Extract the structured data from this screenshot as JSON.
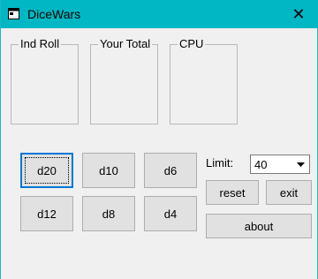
{
  "window": {
    "title": "DiceWars",
    "close_glyph": "✕"
  },
  "groups": {
    "ind_roll": "Ind Roll",
    "your_total": "Your Total",
    "cpu": "CPU"
  },
  "dice_buttons": {
    "d20": "d20",
    "d10": "d10",
    "d6": "d6",
    "d12": "d12",
    "d8": "d8",
    "d4": "d4"
  },
  "limit": {
    "label": "Limit:",
    "value": "40"
  },
  "actions": {
    "reset": "reset",
    "exit": "exit",
    "about": "about"
  },
  "colors": {
    "titlebar": "#00b7c3",
    "focus_border": "#0078d7"
  }
}
